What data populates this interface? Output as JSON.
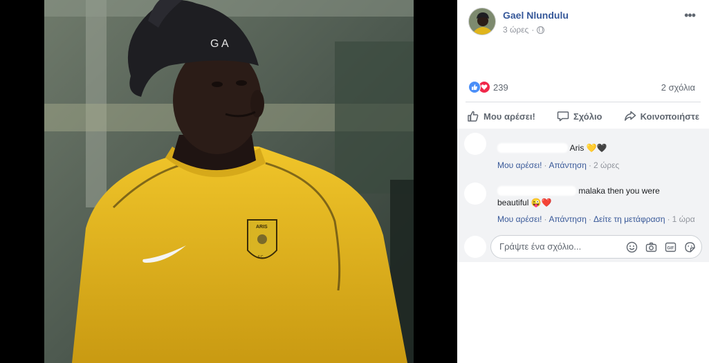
{
  "post": {
    "author": "Gael Nlundulu",
    "time": "3 ώρες",
    "separator": "·",
    "privacy_icon": "globe-icon",
    "more_icon": "ellipsis-icon",
    "more_label": "•••"
  },
  "stats": {
    "reaction_icons": [
      "like-icon",
      "love-icon"
    ],
    "reaction_count": "239",
    "comments_count": "2 σχόλια"
  },
  "actions": {
    "like": "Μου αρέσει!",
    "comment": "Σχόλιο",
    "share": "Κοινοποιήστε"
  },
  "comments": [
    {
      "text": "Aris",
      "emoji": "💛🖤",
      "like": "Μου αρέσει!",
      "reply": "Απάντηση",
      "time": "2 ώρες"
    },
    {
      "text_line1": "malaka then you were",
      "text_line2": "beautiful",
      "emoji": "😜❤️",
      "like": "Μου αρέσει!",
      "reply": "Απάντηση",
      "translate": "Δείτε τη μετάφραση",
      "time": "1 ώρα"
    }
  ],
  "composer": {
    "placeholder": "Γράψτε ένα σχόλιο...",
    "icons": [
      "emoji-icon",
      "camera-icon",
      "gif-icon",
      "sticker-icon"
    ]
  },
  "photo": {
    "beanie_text": "G A",
    "crest_text": "ARIS",
    "crest_sub": "F.C.",
    "colors": {
      "jersey": "#e0b51c",
      "beanie": "#1e1e22",
      "skin": "#2b1c17",
      "background": "#5d6a5d"
    }
  },
  "colors": {
    "link": "#385898",
    "author": "#365899",
    "muted": "#606770",
    "like_blue": "#4b8ff8",
    "love_red": "#f0284a"
  }
}
